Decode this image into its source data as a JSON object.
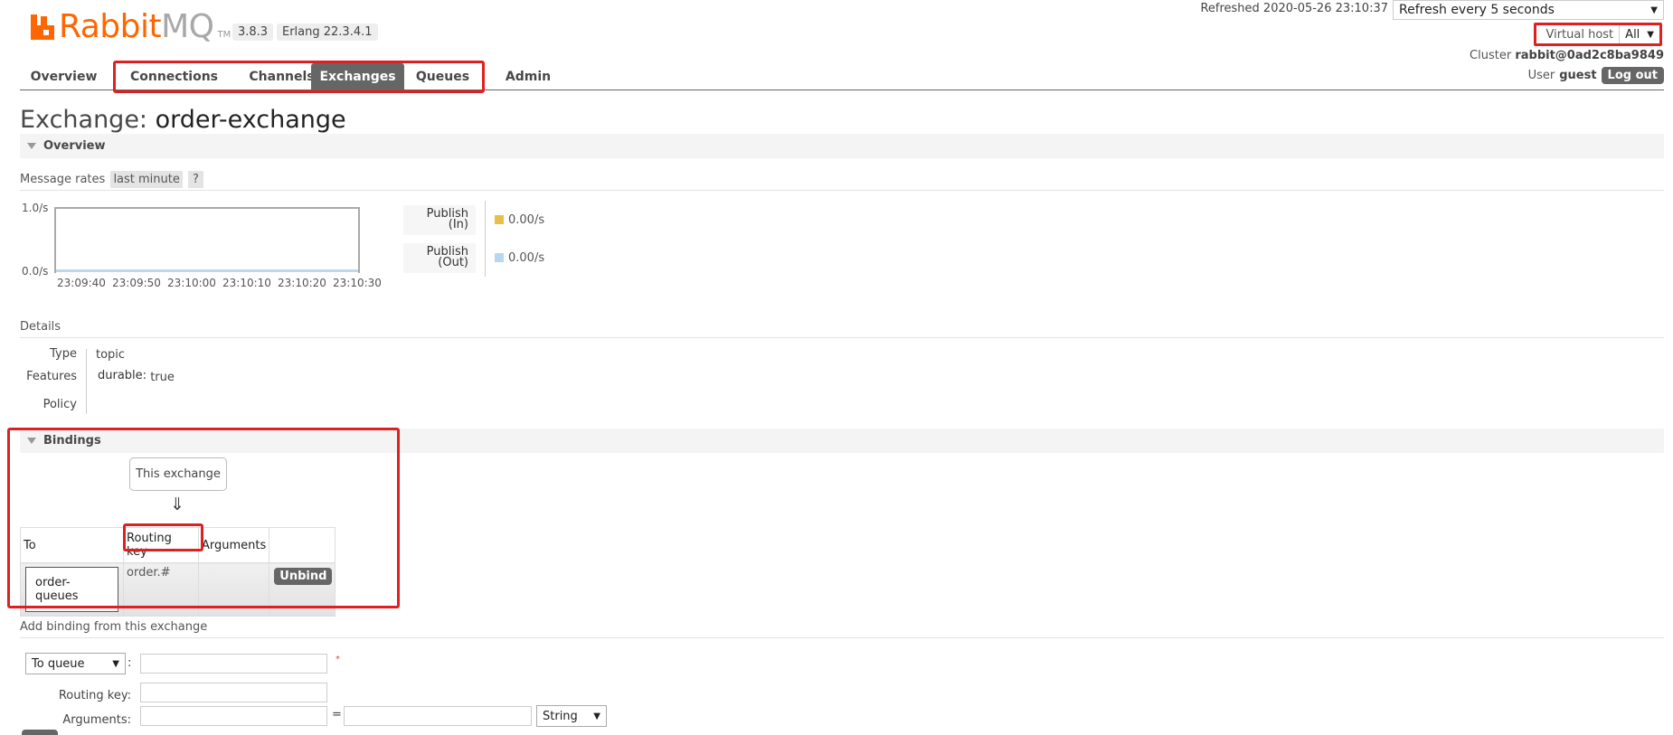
{
  "header": {
    "brand_primary": "Rabbit",
    "brand_secondary": "MQ",
    "trademark": "TM",
    "version": "3.8.3",
    "erlang": "Erlang 22.3.4.1",
    "refreshed": "Refreshed 2020-05-26 23:10:37",
    "refresh_select": "Refresh every 5 seconds",
    "vhost_label": "Virtual host",
    "vhost_value": "All",
    "cluster_label": "Cluster",
    "cluster_name": "rabbit@0ad2c8ba9849",
    "user_label": "User",
    "user_name": "guest",
    "logout_label": "Log out"
  },
  "nav": {
    "tabs": [
      {
        "label": "Overview",
        "active": false
      },
      {
        "label": "Connections",
        "active": false
      },
      {
        "label": "Channels",
        "active": false
      },
      {
        "label": "Exchanges",
        "active": true
      },
      {
        "label": "Queues",
        "active": false
      },
      {
        "label": "Admin",
        "active": false
      }
    ]
  },
  "page": {
    "title_prefix": "Exchange:",
    "title_name": "order-exchange"
  },
  "overview": {
    "section_label": "Overview",
    "rates_label": "Message rates",
    "range_pill": "last minute",
    "help": "?",
    "chart_data": {
      "type": "line",
      "y_ticks": [
        "1.0/s",
        "0.0/s"
      ],
      "x_ticks": [
        "23:09:40",
        "23:09:50",
        "23:10:00",
        "23:10:10",
        "23:10:20",
        "23:10:30"
      ],
      "ylim": [
        0,
        1.0
      ],
      "series": [
        {
          "name": "Publish (In)",
          "values": [
            0,
            0,
            0,
            0,
            0,
            0
          ],
          "color": "#edc240"
        },
        {
          "name": "Publish (Out)",
          "values": [
            0,
            0,
            0,
            0,
            0,
            0
          ],
          "color": "#afd8f8"
        }
      ]
    },
    "legend": [
      {
        "line1": "Publish",
        "line2": "(In)",
        "value": "0.00/s",
        "color": "#e6c04a"
      },
      {
        "line1": "Publish",
        "line2": "(Out)",
        "value": "0.00/s",
        "color": "#b7d6f2"
      }
    ]
  },
  "details": {
    "heading": "Details",
    "type_label": "Type",
    "type_value": "topic",
    "features_label": "Features",
    "features_key": "durable:",
    "features_value": "true",
    "policy_label": "Policy"
  },
  "bindings": {
    "section_label": "Bindings",
    "source_box": "This exchange",
    "arrow": "⇓",
    "columns": [
      "To",
      "Routing key",
      "Arguments",
      ""
    ],
    "rows": [
      {
        "to": "order-queues",
        "routing_key": "order.#",
        "arguments": "",
        "action": "Unbind"
      }
    ]
  },
  "add_binding": {
    "heading": "Add binding from this exchange",
    "target_select": "To queue",
    "colon": ":",
    "required_mark": "*",
    "routing_key_label": "Routing key:",
    "arguments_label": "Arguments:",
    "equals": "=",
    "type_select": "String",
    "destination_value": "",
    "routing_key_value": "",
    "arg_key_value": "",
    "arg_value_value": ""
  }
}
